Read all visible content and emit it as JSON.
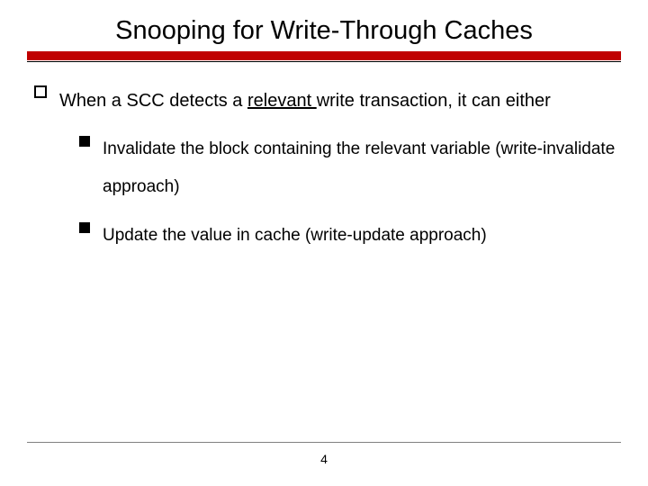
{
  "title": "Snooping for Write-Through Caches",
  "main_bullet": {
    "prefix": "When a SCC detects a ",
    "underlined": "relevant ",
    "suffix": "write transaction, it can either"
  },
  "sub_bullets": [
    "Invalidate the block containing the relevant variable (write-invalidate approach)",
    "Update the value in cache (write-update approach)"
  ],
  "page_number": "4"
}
